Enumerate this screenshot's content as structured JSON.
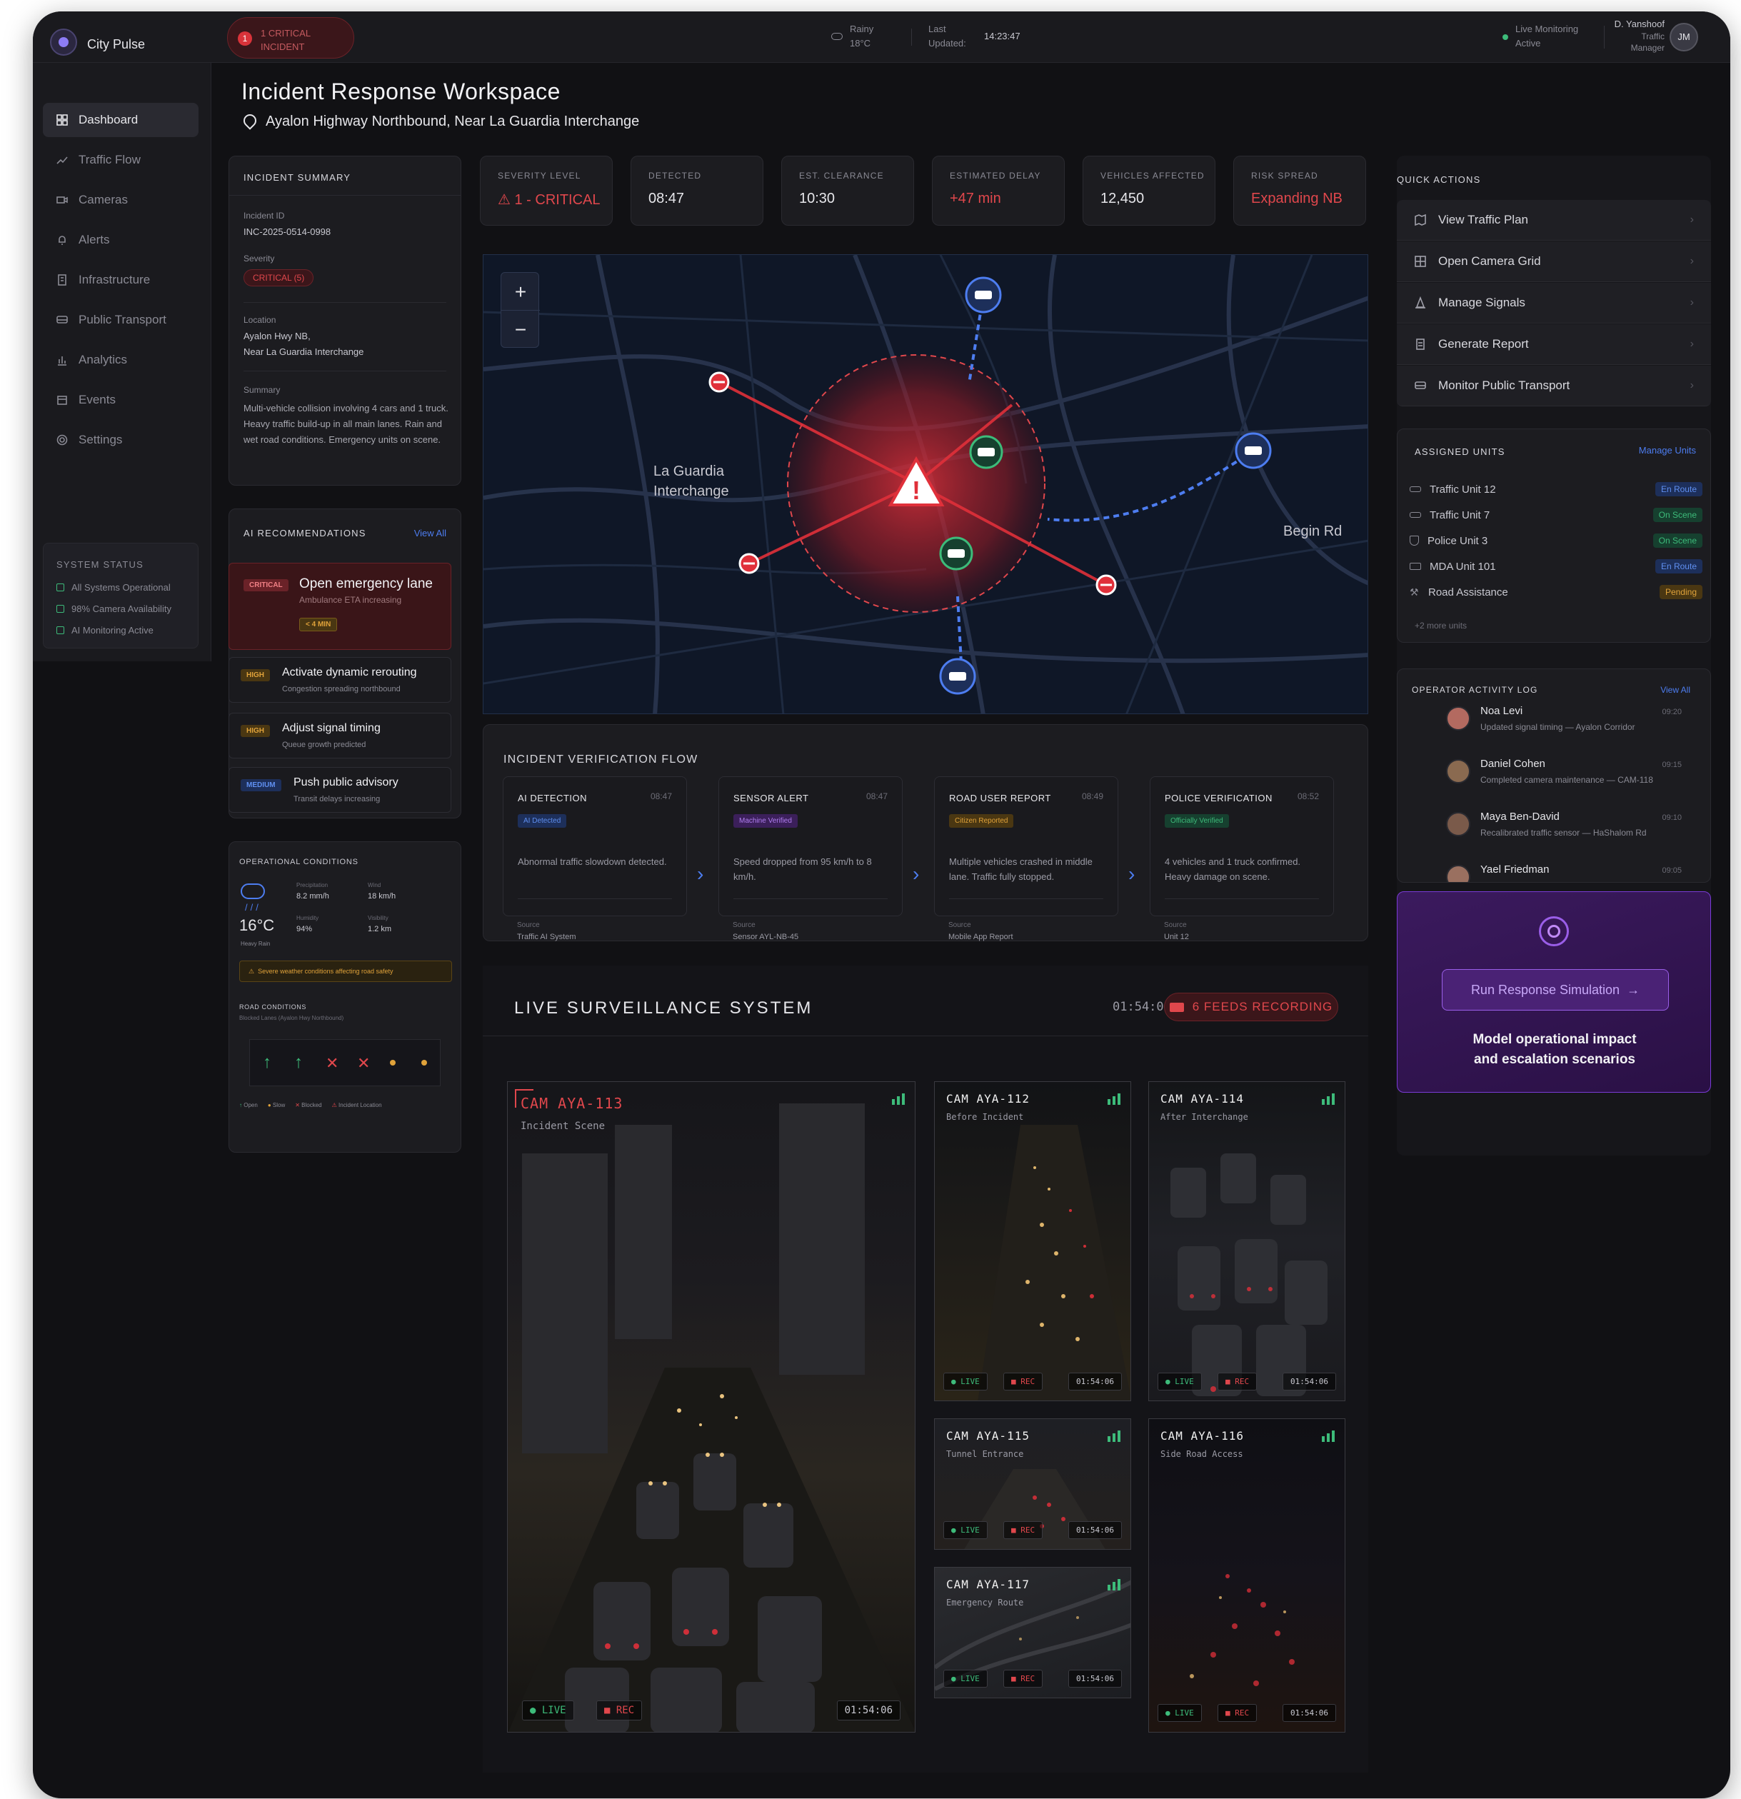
{
  "app": {
    "name": "City Pulse"
  },
  "topbar": {
    "incident_count": "1",
    "incident_line1": "1 CRITICAL",
    "incident_line2": "INCIDENT",
    "weather_cond": "Rainy",
    "weather_temp": "18°C",
    "updated_label1": "Last",
    "updated_label2": "Updated:",
    "updated_time": "14:23:47",
    "monitor_line1": "Live Monitoring",
    "monitor_line2": "Active",
    "user_name": "D. Yanshoof",
    "user_role1": "Traffic",
    "user_role2": "Manager",
    "user_initials": "JM"
  },
  "sidebar": {
    "items": [
      {
        "label": "Dashboard",
        "icon": "grid-icon"
      },
      {
        "label": "Traffic Flow",
        "icon": "trend-icon"
      },
      {
        "label": "Cameras",
        "icon": "camera-icon"
      },
      {
        "label": "Alerts",
        "icon": "bell-icon"
      },
      {
        "label": "Infrastructure",
        "icon": "building-icon"
      },
      {
        "label": "Public Transport",
        "icon": "bus-icon"
      },
      {
        "label": "Analytics",
        "icon": "bar-chart-icon"
      },
      {
        "label": "Events",
        "icon": "calendar-icon"
      },
      {
        "label": "Settings",
        "icon": "gear-icon"
      }
    ],
    "status_title": "SYSTEM STATUS",
    "status": [
      "All Systems Operational",
      "98% Camera Availability",
      "AI Monitoring Active"
    ]
  },
  "page": {
    "title": "Incident Response Workspace",
    "location": "Ayalon Highway Northbound, Near La Guardia Interchange"
  },
  "summary": {
    "title": "INCIDENT SUMMARY",
    "id_label": "Incident ID",
    "id_value": "INC-2025-0514-0998",
    "severity_label": "Severity",
    "severity_value": "CRITICAL (5)",
    "location_label": "Location",
    "location_line1": "Ayalon Hwy NB,",
    "location_line2": "Near La Guardia Interchange",
    "summary_label": "Summary",
    "summary_text": "Multi-vehicle collision involving 4 cars and 1 truck. Heavy traffic build-up in all main lanes. Rain and wet road conditions. Emergency units on scene."
  },
  "ai": {
    "title": "AI RECOMMENDATIONS",
    "view_all": "View All",
    "items": [
      {
        "tag": "CRITICAL",
        "title": "Open emergency lane",
        "sub": "Ambulance ETA increasing",
        "extra": "< 4 MIN"
      },
      {
        "tag": "HIGH",
        "title": "Activate dynamic rerouting",
        "sub": "Congestion spreading northbound"
      },
      {
        "tag": "HIGH",
        "title": "Adjust signal timing",
        "sub": "Queue growth predicted"
      },
      {
        "tag": "MEDIUM",
        "title": "Push public advisory",
        "sub": "Transit delays increasing"
      }
    ]
  },
  "conditions": {
    "title": "OPERATIONAL CONDITIONS",
    "temp": "16°C",
    "temp_sub": "Heavy Rain",
    "precip_label": "Precipitation",
    "precip": "8.2 mm/h",
    "wind_label": "Wind",
    "wind": "18 km/h",
    "humidity_label": "Humidity",
    "humidity": "94%",
    "visibility_label": "Visibility",
    "visibility": "1.2 km",
    "warning": "Severe weather conditions affecting road safety",
    "road_title": "ROAD CONDITIONS",
    "road_sub": "Blocked Lanes (Ayalon Hwy Northbound)",
    "legend": [
      "Open",
      "Slow",
      "Blocked",
      "Incident Location"
    ]
  },
  "stats": [
    {
      "label": "SEVERITY LEVEL",
      "value": "1 - CRITICAL",
      "color": "#e0474c"
    },
    {
      "label": "DETECTED",
      "value": "08:47",
      "color": "#e6e6ea"
    },
    {
      "label": "EST. CLEARANCE",
      "value": "10:30",
      "color": "#e6e6ea"
    },
    {
      "label": "ESTIMATED DELAY",
      "value": "+47 min",
      "color": "#e0474c"
    },
    {
      "label": "VEHICLES AFFECTED",
      "value": "12,450",
      "color": "#e6e6ea"
    },
    {
      "label": "RISK SPREAD",
      "value": "Expanding NB",
      "color": "#e0474c"
    }
  ],
  "map": {
    "zoom_in": "+",
    "zoom_out": "−",
    "label_interchange_1": "La Guardia",
    "label_interchange_2": "Interchange",
    "label_road": "Begin Rd"
  },
  "verification": {
    "title": "INCIDENT VERIFICATION FLOW",
    "source_label": "Source",
    "steps": [
      {
        "title": "AI DETECTION",
        "time": "08:47",
        "tag": "AI Detected",
        "desc": "Abnormal traffic slowdown detected.",
        "source": "Traffic AI System"
      },
      {
        "title": "SENSOR ALERT",
        "time": "08:47",
        "tag": "Machine Verified",
        "desc": "Speed dropped from 95 km/h to 8 km/h.",
        "source": "Sensor AYL-NB-45"
      },
      {
        "title": "ROAD USER REPORT",
        "time": "08:49",
        "tag": "Citizen Reported",
        "desc": "Multiple vehicles crashed in middle lane. Traffic fully stopped.",
        "source": "Mobile App Report"
      },
      {
        "title": "POLICE VERIFICATION",
        "time": "08:52",
        "tag": "Officially Verified",
        "desc": "4 vehicles and 1 truck confirmed. Heavy damage on scene.",
        "source": "Unit 12"
      }
    ]
  },
  "surveillance": {
    "title": "LIVE SURVEILLANCE SYSTEM",
    "time": "01:54:06",
    "recording": "6 FEEDS RECORDING",
    "live": "LIVE",
    "rec": "REC",
    "cams": [
      {
        "id": "CAM AYA-113",
        "sub": "Incident Scene",
        "ts": "01:54:06"
      },
      {
        "id": "CAM AYA-112",
        "sub": "Before Incident",
        "ts": "01:54:06"
      },
      {
        "id": "CAM AYA-114",
        "sub": "After Interchange",
        "ts": "01:54:06"
      },
      {
        "id": "CAM AYA-115",
        "sub": "Tunnel Entrance",
        "ts": "01:54:06"
      },
      {
        "id": "CAM AYA-116",
        "sub": "Side Road Access",
        "ts": "01:54:06"
      },
      {
        "id": "CAM AYA-117",
        "sub": "Emergency Route",
        "ts": "01:54:06"
      }
    ]
  },
  "quick_actions": {
    "title": "QUICK ACTIONS",
    "items": [
      {
        "label": "View Traffic Plan",
        "icon": "map-icon"
      },
      {
        "label": "Open Camera Grid",
        "icon": "grid-icon"
      },
      {
        "label": "Manage Signals",
        "icon": "traffic-cone-icon"
      },
      {
        "label": "Generate Report",
        "icon": "document-icon"
      },
      {
        "label": "Monitor Public Transport",
        "icon": "bus-icon"
      }
    ]
  },
  "units": {
    "title": "ASSIGNED UNITS",
    "manage": "Manage Units",
    "items": [
      {
        "name": "Traffic Unit 12",
        "status": "En Route",
        "kind": "route"
      },
      {
        "name": "Traffic Unit 7",
        "status": "On Scene",
        "kind": "scene"
      },
      {
        "name": "Police Unit 3",
        "status": "On Scene",
        "kind": "scene"
      },
      {
        "name": "MDA Unit 101",
        "status": "En Route",
        "kind": "route"
      },
      {
        "name": "Road Assistance",
        "status": "Pending",
        "kind": "pend"
      }
    ],
    "more": "+2 more units"
  },
  "activity": {
    "title": "OPERATOR ACTIVITY LOG",
    "view_all": "View All",
    "items": [
      {
        "name": "Noa Levi",
        "time": "09:20",
        "text": "Updated signal timing — Ayalon Corridor"
      },
      {
        "name": "Daniel Cohen",
        "time": "09:15",
        "text": "Completed camera maintenance — CAM-118"
      },
      {
        "name": "Maya Ben-David",
        "time": "09:10",
        "text": "Recalibrated traffic sensor — HaShalom Rd"
      },
      {
        "name": "Yael Friedman",
        "time": "09:05",
        "text": ""
      }
    ]
  },
  "simulation": {
    "button": "Run Response Simulation",
    "text1": "Model operational impact",
    "text2": "and escalation scenarios"
  },
  "colors": {
    "critical": "#e0474c",
    "accent_blue": "#4d7df0",
    "success": "#3dbb7a",
    "purple": "#7a3bd6"
  }
}
